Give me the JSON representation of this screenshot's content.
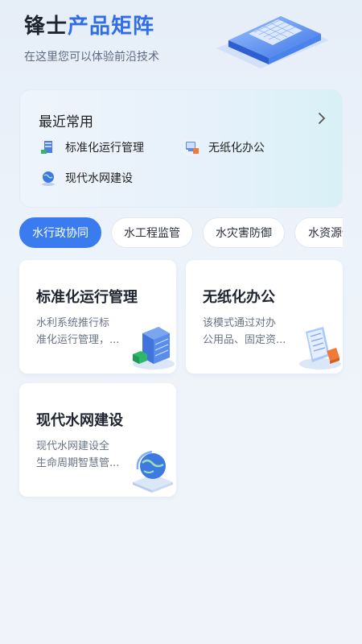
{
  "header": {
    "title_part1": "锋士",
    "title_part2": "产品矩阵",
    "subtitle": "在这里您可以体验前沿技术"
  },
  "recent": {
    "title": "最近常用",
    "items": [
      {
        "label": "标准化运行管理",
        "icon": "server-rack-icon"
      },
      {
        "label": "无纸化办公",
        "icon": "computer-icon"
      },
      {
        "label": "现代水网建设",
        "icon": "globe-icon"
      }
    ]
  },
  "tabs": [
    {
      "label": "水行政协同",
      "active": true
    },
    {
      "label": "水工程监管",
      "active": false
    },
    {
      "label": "水灾害防御",
      "active": false
    },
    {
      "label": "水资源保护",
      "active": false
    }
  ],
  "cards": [
    {
      "title": "标准化运行管理",
      "desc_line1": "水利系统推行标",
      "desc_line2": "准化运行管理，...",
      "icon": "server-rack-icon"
    },
    {
      "title": "无纸化办公",
      "desc_line1": "该模式通过对办",
      "desc_line2": "公用品、固定资...",
      "icon": "document-icon"
    },
    {
      "title": "现代水网建设",
      "desc_line1": "现代水网建设全",
      "desc_line2": "生命周期智慧管...",
      "icon": "globe-icon"
    }
  ],
  "colors": {
    "accent": "#3a7cf0",
    "title_blue": "#2f6dea",
    "background": "#edf3fa"
  }
}
